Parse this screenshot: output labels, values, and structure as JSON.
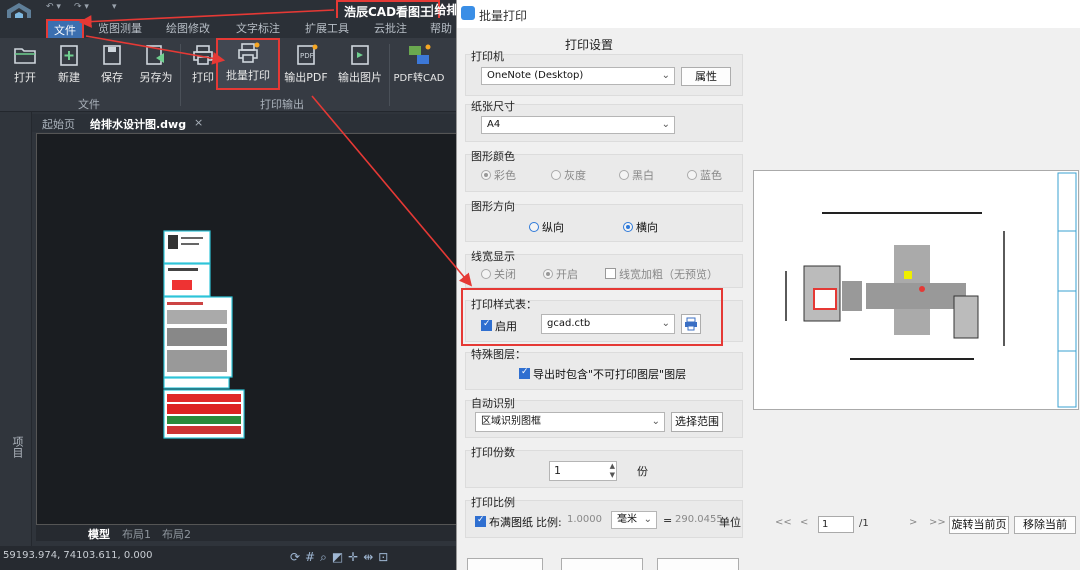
{
  "app": {
    "title": "浩辰CAD看图王",
    "title_rest": "|给排"
  },
  "menu": [
    "文件",
    "览图测量",
    "绘图修改",
    "文字标注",
    "扩展工具",
    "云批注",
    "帮助"
  ],
  "ribbon": {
    "buttons": [
      "打开",
      "新建",
      "保存",
      "另存为",
      "打印",
      "批量打印",
      "输出PDF",
      "输出图片",
      "PDF转CAD"
    ],
    "groups": [
      "文件",
      "打印输出"
    ]
  },
  "tabs": {
    "start": "起始页",
    "doc": "给排水设计图.dwg",
    "close": "×"
  },
  "side_panel": "项目",
  "layout_tabs": [
    "模型",
    "布局1",
    "布局2"
  ],
  "status": {
    "coords": "59193.974, 74103.611, 0.000"
  },
  "dialog": {
    "title": "批量打印",
    "settings_header": "打印设置",
    "printer": {
      "label": "打印机",
      "value": "OneNote (Desktop)",
      "props": "属性"
    },
    "paper": {
      "label": "纸张尺寸",
      "value": "A4"
    },
    "color": {
      "label": "图形颜色",
      "options": [
        "彩色",
        "灰度",
        "黑白",
        "蓝色"
      ]
    },
    "orientation": {
      "label": "图形方向",
      "options": [
        "纵向",
        "横向"
      ]
    },
    "lineweight": {
      "label": "线宽显示",
      "options": [
        "关闭",
        "开启"
      ],
      "thick": "线宽加粗（无预览）"
    },
    "style": {
      "label": "打印样式表：",
      "enable": "启用",
      "value": "gcad.ctb"
    },
    "special": {
      "label": "特殊图层：",
      "option": "导出时包含\"不可打印图层\"图层"
    },
    "auto": {
      "label": "自动识别",
      "value": "区域识别图框",
      "range_btn": "选择范围"
    },
    "copies": {
      "label": "打印份数",
      "value": "1",
      "unit": "份"
    },
    "scale": {
      "label": "打印比例",
      "fill": "布满图纸",
      "ratio_label": "比例:",
      "ratio_value": "1.0000",
      "unit": "毫米",
      "equals": "=",
      "result": "290.0455",
      "unit2": "单位"
    },
    "nav": {
      "first": "<<",
      "prev": "<",
      "page": "1",
      "total": "/1",
      "next": ">",
      "last": ">>",
      "rotate": "旋转当前页",
      "remove": "移除当前"
    }
  }
}
